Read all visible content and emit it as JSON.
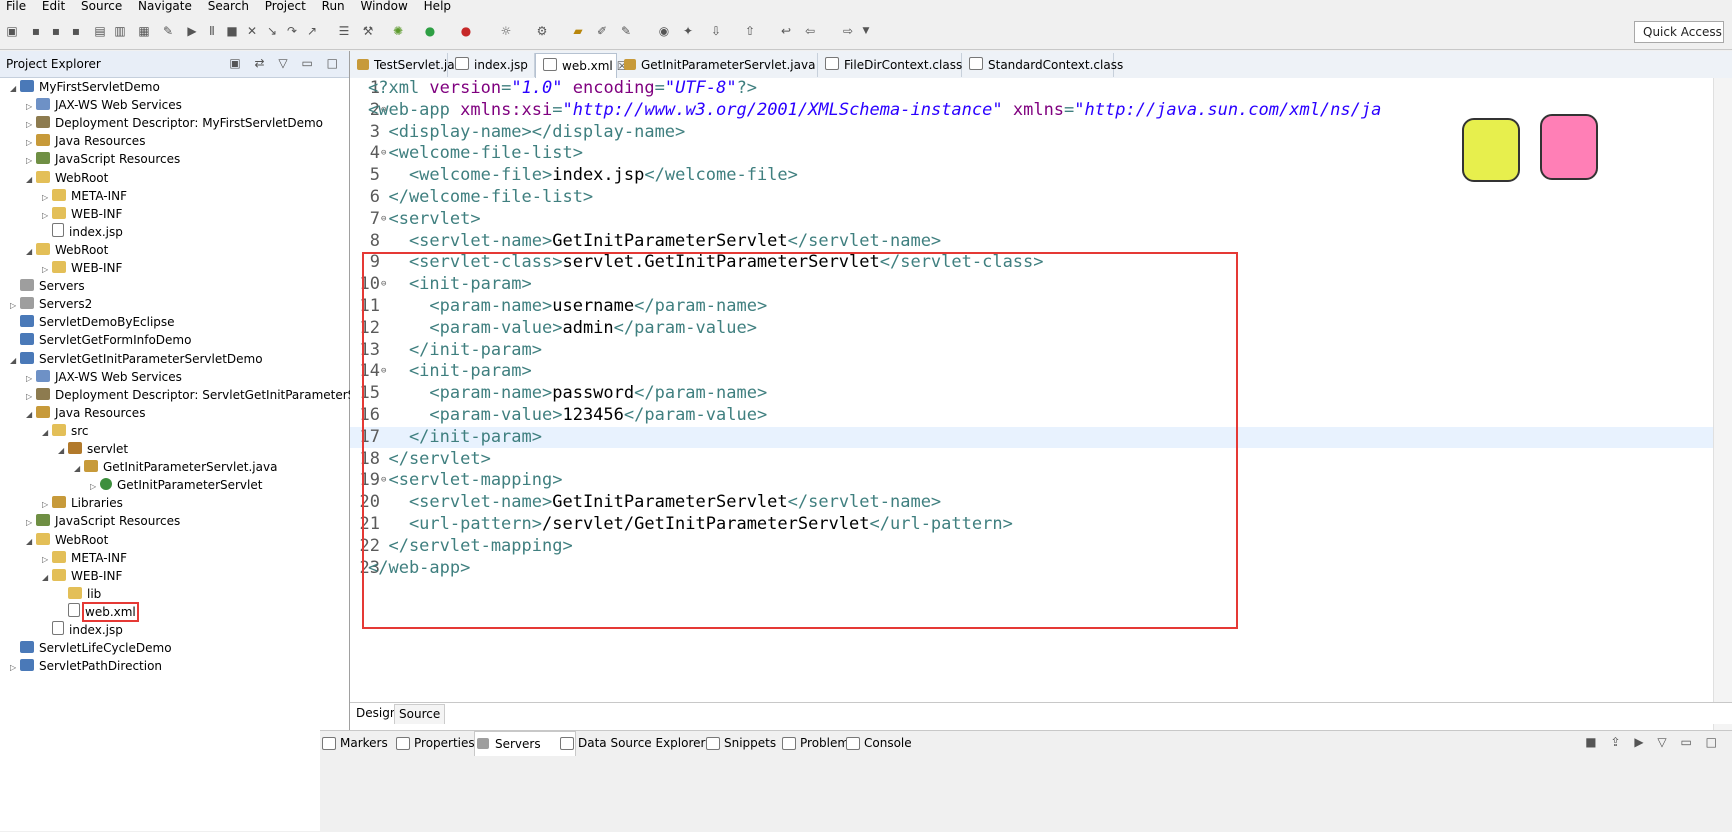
{
  "menu": [
    "File",
    "Edit",
    "Source",
    "Navigate",
    "Search",
    "Project",
    "Run",
    "Window",
    "Help"
  ],
  "quick_access": "Quick Access",
  "explorer": {
    "title": "Project Explorer",
    "items": [
      {
        "label": "MyFirstServletDemo",
        "depth": 0,
        "arrow": "◢",
        "icon": "project-icon"
      },
      {
        "label": "JAX-WS Web Services",
        "depth": 1,
        "arrow": "▷",
        "icon": "web-service-icon"
      },
      {
        "label": "Deployment Descriptor: MyFirstServletDemo",
        "depth": 1,
        "arrow": "▷",
        "icon": "deployment-descriptor-icon"
      },
      {
        "label": "Java Resources",
        "depth": 1,
        "arrow": "▷",
        "icon": "java-resources-icon"
      },
      {
        "label": "JavaScript Resources",
        "depth": 1,
        "arrow": "▷",
        "icon": "javascript-resources-icon"
      },
      {
        "label": "WebRoot",
        "depth": 1,
        "arrow": "◢",
        "icon": "folder-icon"
      },
      {
        "label": "META-INF",
        "depth": 2,
        "arrow": "▷",
        "icon": "folder-icon"
      },
      {
        "label": "WEB-INF",
        "depth": 2,
        "arrow": "▷",
        "icon": "folder-icon"
      },
      {
        "label": "index.jsp",
        "depth": 2,
        "arrow": "",
        "icon": "file-icon"
      },
      {
        "label": "WebRoot",
        "depth": 1,
        "arrow": "◢",
        "icon": "folder-icon"
      },
      {
        "label": "WEB-INF",
        "depth": 2,
        "arrow": "▷",
        "icon": "folder-icon"
      },
      {
        "label": "Servers",
        "depth": 0,
        "arrow": "",
        "icon": "server-icon"
      },
      {
        "label": "Servers2",
        "depth": 0,
        "arrow": "▷",
        "icon": "server-icon"
      },
      {
        "label": "ServletDemoByEclipse",
        "depth": 0,
        "arrow": "",
        "icon": "project-icon"
      },
      {
        "label": "ServletGetFormInfoDemo",
        "depth": 0,
        "arrow": "",
        "icon": "project-icon"
      },
      {
        "label": "ServletGetInitParameterServletDemo",
        "depth": 0,
        "arrow": "◢",
        "icon": "project-icon"
      },
      {
        "label": "JAX-WS Web Services",
        "depth": 1,
        "arrow": "▷",
        "icon": "web-service-icon"
      },
      {
        "label": "Deployment Descriptor: ServletGetInitParameterS",
        "depth": 1,
        "arrow": "▷",
        "icon": "deployment-descriptor-icon"
      },
      {
        "label": "Java Resources",
        "depth": 1,
        "arrow": "◢",
        "icon": "java-resources-icon"
      },
      {
        "label": "src",
        "depth": 2,
        "arrow": "◢",
        "icon": "source-folder-icon"
      },
      {
        "label": "servlet",
        "depth": 3,
        "arrow": "◢",
        "icon": "package-icon"
      },
      {
        "label": "GetInitParameterServlet.java",
        "depth": 4,
        "arrow": "◢",
        "icon": "java-file-icon"
      },
      {
        "label": "GetInitParameterServlet",
        "depth": 5,
        "arrow": "▷",
        "icon": "class-icon"
      },
      {
        "label": "Libraries",
        "depth": 2,
        "arrow": "▷",
        "icon": "library-icon"
      },
      {
        "label": "JavaScript Resources",
        "depth": 1,
        "arrow": "▷",
        "icon": "javascript-resources-icon"
      },
      {
        "label": "WebRoot",
        "depth": 1,
        "arrow": "◢",
        "icon": "folder-icon"
      },
      {
        "label": "META-INF",
        "depth": 2,
        "arrow": "▷",
        "icon": "folder-icon"
      },
      {
        "label": "WEB-INF",
        "depth": 2,
        "arrow": "◢",
        "icon": "folder-icon"
      },
      {
        "label": "lib",
        "depth": 3,
        "arrow": "",
        "icon": "folder-icon"
      },
      {
        "label": "web.xml",
        "depth": 3,
        "arrow": "",
        "icon": "xml-file-icon",
        "highlighted": true
      },
      {
        "label": "index.jsp",
        "depth": 2,
        "arrow": "",
        "icon": "file-icon"
      },
      {
        "label": "ServletLifeCycleDemo",
        "depth": 0,
        "arrow": "",
        "icon": "project-icon"
      },
      {
        "label": "ServletPathDirection",
        "depth": 0,
        "arrow": "▷",
        "icon": "project-icon"
      }
    ]
  },
  "editor": {
    "tabs": [
      {
        "label": "TestServlet.java",
        "icon": "java-file-icon"
      },
      {
        "label": "index.jsp",
        "icon": "file-icon"
      },
      {
        "label": "web.xml",
        "icon": "xml-file-icon",
        "active": true
      },
      {
        "label": "GetInitParameterServlet.java",
        "icon": "java-file-icon"
      },
      {
        "label": "FileDirContext.class",
        "icon": "class-file-icon"
      },
      {
        "label": "StandardContext.class",
        "icon": "class-file-icon"
      }
    ],
    "lines": [
      {
        "num": "1",
        "fold": "",
        "parts": [
          {
            "c": "tag",
            "t": "<?xml "
          },
          {
            "c": "attr",
            "t": "version"
          },
          {
            "c": "tag",
            "t": "="
          },
          {
            "c": "val",
            "t": "\"1.0\""
          },
          {
            "c": "tag",
            "t": " "
          },
          {
            "c": "attr",
            "t": "encoding"
          },
          {
            "c": "tag",
            "t": "="
          },
          {
            "c": "val",
            "t": "\"UTF-8\""
          },
          {
            "c": "tag",
            "t": "?>"
          }
        ]
      },
      {
        "num": "2",
        "fold": "⊖",
        "parts": [
          {
            "c": "tag",
            "t": "<web-app "
          },
          {
            "c": "attr",
            "t": "xmlns:xsi"
          },
          {
            "c": "tag",
            "t": "="
          },
          {
            "c": "val",
            "t": "\"http://www.w3.org/2001/XMLSchema-instance\""
          },
          {
            "c": "tag",
            "t": " "
          },
          {
            "c": "attr",
            "t": "xmlns"
          },
          {
            "c": "tag",
            "t": "="
          },
          {
            "c": "val",
            "t": "\"http://java.sun.com/xml/ns/ja"
          }
        ]
      },
      {
        "num": "3",
        "fold": "",
        "parts": [
          {
            "c": "tag",
            "t": "  <display-name></display-name>"
          }
        ]
      },
      {
        "num": "4",
        "fold": "⊖",
        "parts": [
          {
            "c": "tag",
            "t": "  <welcome-file-list>"
          }
        ]
      },
      {
        "num": "5",
        "fold": "",
        "parts": [
          {
            "c": "tag",
            "t": "    <welcome-file>"
          },
          {
            "c": "txt",
            "t": "index.jsp"
          },
          {
            "c": "tag",
            "t": "</welcome-file>"
          }
        ]
      },
      {
        "num": "6",
        "fold": "",
        "parts": [
          {
            "c": "tag",
            "t": "  </welcome-file-list>"
          }
        ]
      },
      {
        "num": "7",
        "fold": "⊖",
        "parts": [
          {
            "c": "tag",
            "t": "  <servlet>"
          }
        ]
      },
      {
        "num": "8",
        "fold": "",
        "parts": [
          {
            "c": "tag",
            "t": "    <servlet-name>"
          },
          {
            "c": "txt",
            "t": "GetInitParameterServlet"
          },
          {
            "c": "tag",
            "t": "</servlet-name>"
          }
        ]
      },
      {
        "num": "9",
        "fold": "",
        "parts": [
          {
            "c": "tag",
            "t": "    <servlet-class>"
          },
          {
            "c": "txt",
            "t": "servlet.GetInitParameterServlet"
          },
          {
            "c": "tag",
            "t": "</servlet-class>"
          }
        ]
      },
      {
        "num": "10",
        "fold": "⊖",
        "parts": [
          {
            "c": "tag",
            "t": "    <init-param>"
          }
        ]
      },
      {
        "num": "11",
        "fold": "",
        "parts": [
          {
            "c": "tag",
            "t": "      <param-name>"
          },
          {
            "c": "txt",
            "t": "username"
          },
          {
            "c": "tag",
            "t": "</param-name>"
          }
        ]
      },
      {
        "num": "12",
        "fold": "",
        "parts": [
          {
            "c": "tag",
            "t": "      <param-value>"
          },
          {
            "c": "txt",
            "t": "admin"
          },
          {
            "c": "tag",
            "t": "</param-value>"
          }
        ]
      },
      {
        "num": "13",
        "fold": "",
        "parts": [
          {
            "c": "tag",
            "t": "    </init-param>"
          }
        ]
      },
      {
        "num": "14",
        "fold": "⊖",
        "parts": [
          {
            "c": "tag",
            "t": "    <init-param>"
          }
        ]
      },
      {
        "num": "15",
        "fold": "",
        "parts": [
          {
            "c": "tag",
            "t": "      <param-name>"
          },
          {
            "c": "txt",
            "t": "password"
          },
          {
            "c": "tag",
            "t": "</param-name>"
          }
        ]
      },
      {
        "num": "16",
        "fold": "",
        "parts": [
          {
            "c": "tag",
            "t": "      <param-value>"
          },
          {
            "c": "txt",
            "t": "123456"
          },
          {
            "c": "tag",
            "t": "</param-value>"
          }
        ]
      },
      {
        "num": "17",
        "fold": "",
        "parts": [
          {
            "c": "tag",
            "t": "    </init-param>"
          }
        ],
        "current": true
      },
      {
        "num": "18",
        "fold": "",
        "parts": [
          {
            "c": "tag",
            "t": "  </servlet>"
          }
        ]
      },
      {
        "num": "19",
        "fold": "⊖",
        "parts": [
          {
            "c": "tag",
            "t": "  <servlet-mapping>"
          }
        ]
      },
      {
        "num": "20",
        "fold": "",
        "parts": [
          {
            "c": "tag",
            "t": "    <servlet-name>"
          },
          {
            "c": "txt",
            "t": "GetInitParameterServlet"
          },
          {
            "c": "tag",
            "t": "</servlet-name>"
          }
        ]
      },
      {
        "num": "21",
        "fold": "",
        "parts": [
          {
            "c": "tag",
            "t": "    <url-pattern>"
          },
          {
            "c": "txt",
            "t": "/servlet/GetInitParameterServlet"
          },
          {
            "c": "tag",
            "t": "</url-pattern>"
          }
        ]
      },
      {
        "num": "22",
        "fold": "",
        "parts": [
          {
            "c": "tag",
            "t": "  </servlet-mapping>"
          }
        ]
      },
      {
        "num": "23",
        "fold": "",
        "parts": [
          {
            "c": "tag",
            "t": "</web-app>"
          }
        ]
      }
    ],
    "subtabs": [
      "Design",
      "Source"
    ]
  },
  "bottom_tabs": [
    {
      "label": "Markers",
      "icon": "markers-icon"
    },
    {
      "label": "Properties",
      "icon": "properties-icon"
    },
    {
      "label": "Servers",
      "icon": "servers-icon",
      "active": true
    },
    {
      "label": "Data Source Explorer",
      "icon": "data-source-icon"
    },
    {
      "label": "Snippets",
      "icon": "snippets-icon"
    },
    {
      "label": "Problems",
      "icon": "problems-icon"
    },
    {
      "label": "Console",
      "icon": "console-icon"
    }
  ],
  "colors": {
    "red_highlight": "#e53935",
    "current_line": "#e8f2fe",
    "tag": "#3f7f7f",
    "attribute": "#7f007f",
    "value": "#2a00ff"
  }
}
